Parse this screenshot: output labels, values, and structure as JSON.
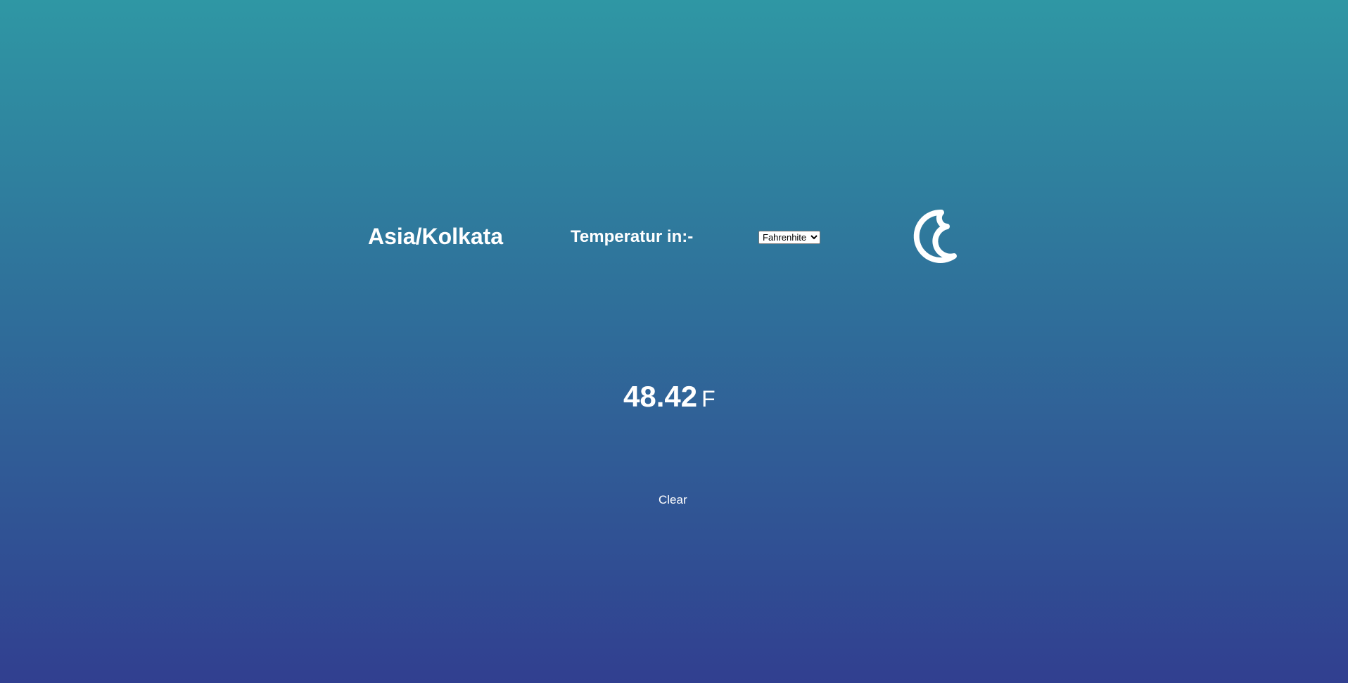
{
  "location": "Asia/Kolkata",
  "temperature_label": "Temperatur in:-",
  "unit_select": {
    "selected": "Fahrenhite"
  },
  "weather_icon": "moon-icon",
  "reading": {
    "value": "48.42",
    "unit": "F"
  },
  "clear_label": "Clear",
  "colors": {
    "gradient_top": "#2f97a4",
    "gradient_bottom": "#313f90",
    "text": "#ffffff"
  }
}
